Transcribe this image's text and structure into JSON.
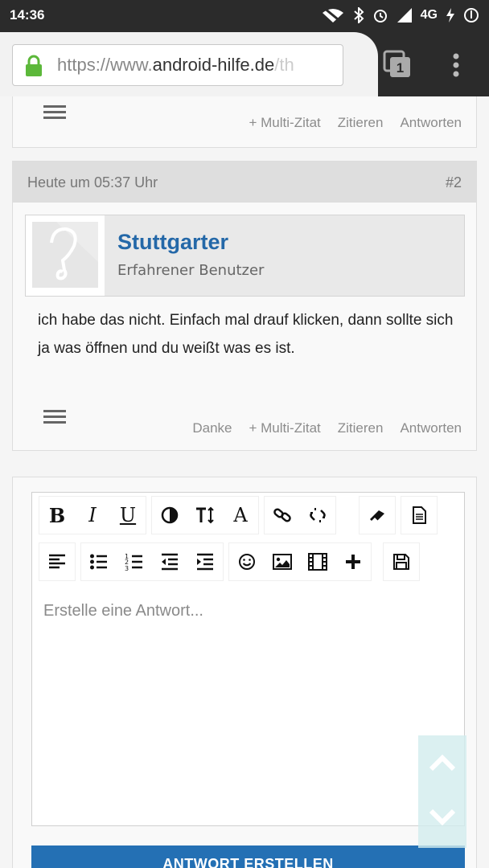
{
  "status_bar": {
    "time": "14:36",
    "network": "4G",
    "icons": [
      "wifi-off-icon",
      "bluetooth-icon",
      "alarm-icon",
      "signal-icon",
      "network-4g",
      "charging-icon",
      "data-saver-icon"
    ]
  },
  "browser": {
    "url_prefix": "https://www.",
    "url_domain": "android-hilfe.de",
    "url_suffix": "/th",
    "tab_count": "1"
  },
  "post1": {
    "actions": [
      "+ Multi-Zitat",
      "Zitieren",
      "Antworten"
    ]
  },
  "post2": {
    "date": "Heute um 05:37 Uhr",
    "number": "#2",
    "username": "Stuttgarter",
    "user_title": "Erfahrener Benutzer",
    "message": "ich habe das nicht. Einfach mal drauf klicken, dann sollte sich ja was öffnen und du weißt was es ist.",
    "actions": [
      "Danke",
      "+ Multi-Zitat",
      "Zitieren",
      "Antworten"
    ]
  },
  "editor": {
    "placeholder": "Erstelle eine Antwort...",
    "bold": "B",
    "italic": "I",
    "underline": "U",
    "font_family": "A",
    "submit_label": "ANTWORT ERSTELLEN"
  },
  "colors": {
    "link_blue": "#2468a8",
    "button_blue": "#2470b4",
    "lock_green": "#5cb83a"
  }
}
